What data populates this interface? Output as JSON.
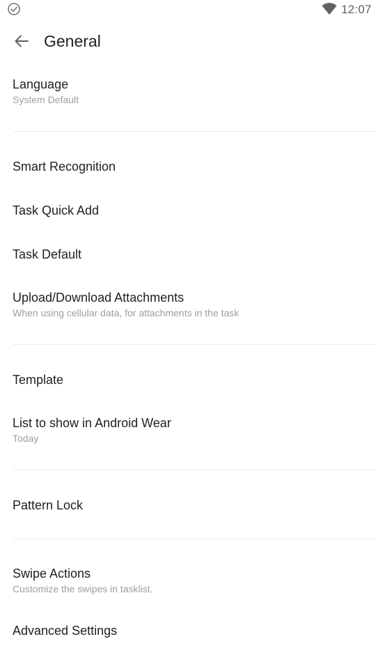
{
  "status_bar": {
    "time": "12:07",
    "left_icon": "check-circle-icon",
    "wifi_icon": "wifi-icon"
  },
  "app_bar": {
    "back_icon": "arrow-back-icon",
    "title": "General"
  },
  "settings": {
    "language": {
      "title": "Language",
      "summary": "System Default"
    },
    "smart_recognition": {
      "title": "Smart Recognition"
    },
    "task_quick_add": {
      "title": "Task Quick Add"
    },
    "task_default": {
      "title": "Task Default"
    },
    "attachments": {
      "title": "Upload/Download Attachments",
      "summary": "When using cellular data, for attachments in the task"
    },
    "template": {
      "title": "Template"
    },
    "android_wear": {
      "title": "List to show in Android Wear",
      "summary": "Today"
    },
    "pattern_lock": {
      "title": "Pattern Lock"
    },
    "swipe_actions": {
      "title": "Swipe Actions",
      "summary": "Customize the swipes in tasklist."
    },
    "advanced": {
      "title": "Advanced Settings"
    }
  },
  "colors": {
    "text_primary": "#212121",
    "text_secondary": "#9e9e9e",
    "divider": "#ececec",
    "icon": "#616161"
  }
}
